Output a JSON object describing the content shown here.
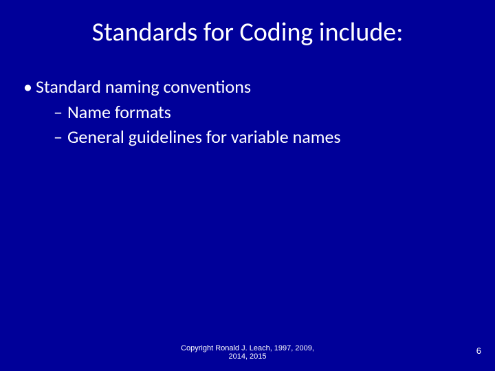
{
  "slide": {
    "title": "Standards for Coding include:",
    "bullets": {
      "b1": "Standard naming conventions",
      "b1_1": "Name formats",
      "b1_2": "General guidelines for variable names"
    },
    "footer_line1": "Copyright Ronald J. Leach, 1997, 2009,",
    "footer_line2": "2014, 2015",
    "page_number": "6"
  }
}
